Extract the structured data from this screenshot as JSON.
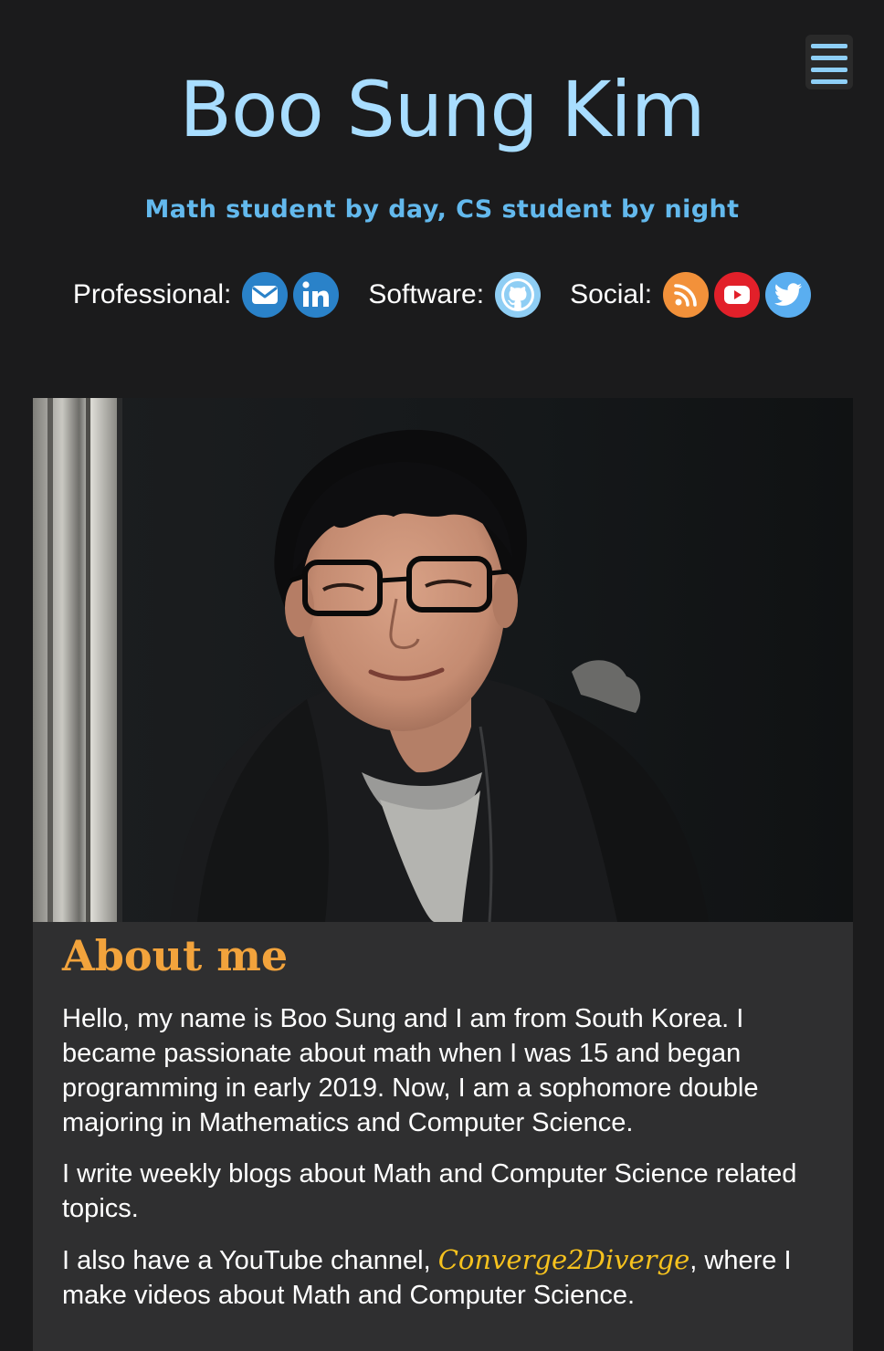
{
  "header": {
    "title": "Boo Sung Kim",
    "tagline": "Math student by day, CS student by night"
  },
  "menu": {
    "icon": "hamburger-menu-icon"
  },
  "social": {
    "groups": [
      {
        "label": "Professional:",
        "icons": [
          {
            "name": "email-icon",
            "color": "#2a82c9"
          },
          {
            "name": "linkedin-icon",
            "color": "#2a82c9"
          }
        ]
      },
      {
        "label": "Software:",
        "icons": [
          {
            "name": "github-icon",
            "color": "#8fcef4"
          }
        ]
      },
      {
        "label": "Social:",
        "icons": [
          {
            "name": "rss-icon",
            "color": "#f2913a"
          },
          {
            "name": "youtube-icon",
            "color": "#e2202a"
          },
          {
            "name": "twitter-icon",
            "color": "#5aaef0"
          }
        ]
      }
    ]
  },
  "about": {
    "title": "About me",
    "paragraph1": "Hello, my name is Boo Sung and I am from South Korea. I became passionate about math when I was 15 and began programming in early 2019. Now, I am a sophomore double majoring in Mathematics and Computer Science.",
    "paragraph2": "I write weekly blogs about Math and Computer Science related topics.",
    "paragraph3_before": "I also have a YouTube channel, ",
    "channel_link": "Converge2Diverge",
    "paragraph3_after": ", where I make videos about Math and Computer Science."
  },
  "colors": {
    "background": "#1b1b1c",
    "title": "#a8ddff",
    "tagline": "#63b9ed",
    "about_heading": "#f2a33c",
    "link": "#f6c21e"
  }
}
